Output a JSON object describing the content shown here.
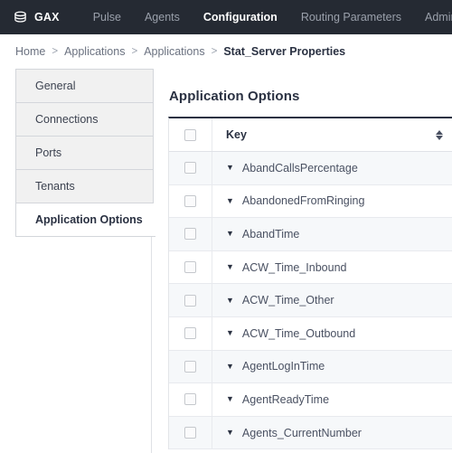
{
  "topnav": {
    "logo_icon": "genesys-stacked-discs-icon",
    "brand": "GAX",
    "items": [
      {
        "label": "Pulse",
        "active": false
      },
      {
        "label": "Agents",
        "active": false
      },
      {
        "label": "Configuration",
        "active": true
      },
      {
        "label": "Routing Parameters",
        "active": false
      },
      {
        "label": "Administration",
        "active": false
      }
    ],
    "accent_color": "#3f7fd4",
    "background_color": "#252a33"
  },
  "breadcrumb": {
    "separator": ">",
    "items": [
      {
        "label": "Home",
        "current": false
      },
      {
        "label": "Applications",
        "current": false
      },
      {
        "label": "Applications",
        "current": false
      },
      {
        "label": "Stat_Server Properties",
        "current": true
      }
    ]
  },
  "sidebar": {
    "items": [
      {
        "label": "General",
        "active": false
      },
      {
        "label": "Connections",
        "active": false
      },
      {
        "label": "Ports",
        "active": false
      },
      {
        "label": "Tenants",
        "active": false
      },
      {
        "label": "Application Options",
        "active": true
      }
    ]
  },
  "main": {
    "title": "Application Options",
    "table": {
      "select_all_checkbox": "unchecked",
      "sort_icon": "sort-ascending-descending-icon",
      "columns": [
        "Key"
      ],
      "rows": [
        {
          "key": "AbandCallsPercentage",
          "expander": "collapsed-caret-icon",
          "checkbox": "unchecked"
        },
        {
          "key": "AbandonedFromRinging",
          "expander": "collapsed-caret-icon",
          "checkbox": "unchecked"
        },
        {
          "key": "AbandTime",
          "expander": "collapsed-caret-icon",
          "checkbox": "unchecked"
        },
        {
          "key": "ACW_Time_Inbound",
          "expander": "collapsed-caret-icon",
          "checkbox": "unchecked"
        },
        {
          "key": "ACW_Time_Other",
          "expander": "collapsed-caret-icon",
          "checkbox": "unchecked"
        },
        {
          "key": "ACW_Time_Outbound",
          "expander": "collapsed-caret-icon",
          "checkbox": "unchecked"
        },
        {
          "key": "AgentLogInTime",
          "expander": "collapsed-caret-icon",
          "checkbox": "unchecked"
        },
        {
          "key": "AgentReadyTime",
          "expander": "collapsed-caret-icon",
          "checkbox": "unchecked"
        },
        {
          "key": "Agents_CurrentNumber",
          "expander": "collapsed-caret-icon",
          "checkbox": "unchecked"
        }
      ]
    }
  }
}
